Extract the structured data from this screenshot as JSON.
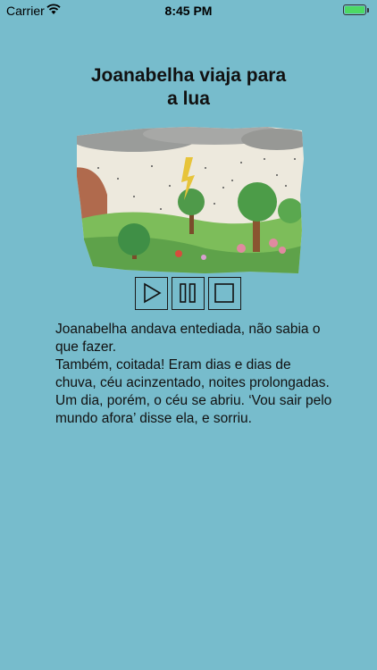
{
  "status_bar": {
    "carrier": "Carrier",
    "time": "8:45 PM",
    "battery_level": 1.0,
    "battery_color": "#4cd964"
  },
  "book": {
    "title_line1": "Joanabelha viaja para",
    "title_line2": "a lua"
  },
  "controls": {
    "play_icon": "play-icon",
    "pause_icon": "pause-icon",
    "stop_icon": "stop-icon"
  },
  "story": {
    "lines": [
      "Joanabelha andava entediada, não sabia o que fazer.",
      "Também, coitada! Eram dias e dias de chuva, céu acinzentado, noites prolongadas.",
      "Um dia, porém, o céu se abriu. ‘Vou sair pelo mundo afora’ disse ela, e sorriu."
    ]
  },
  "colors": {
    "background": "#77bccc",
    "text": "#111111"
  }
}
